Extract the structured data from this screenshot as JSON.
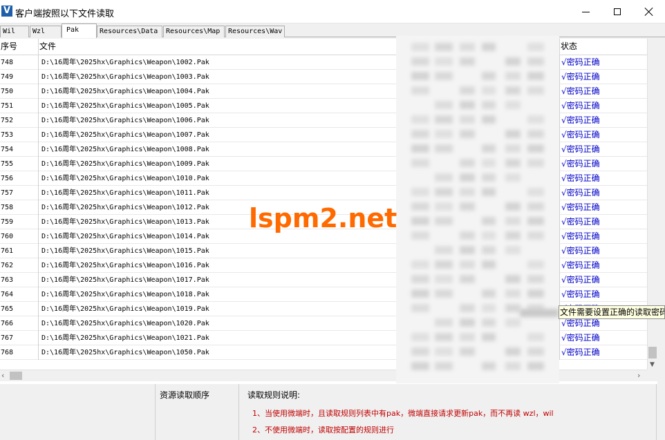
{
  "window": {
    "title": "客户端按照以下文件读取",
    "icon_letter": "V"
  },
  "tabs": [
    {
      "label": "Wil",
      "active": false
    },
    {
      "label": "Wzl",
      "active": false
    },
    {
      "label": "Pak",
      "active": true
    },
    {
      "label": "Resources\\Data",
      "active": false
    },
    {
      "label": "Resources\\Map",
      "active": false
    },
    {
      "label": "Resources\\Wav",
      "active": false
    }
  ],
  "table": {
    "columns": [
      "序号",
      "文件",
      "状态"
    ],
    "rows": [
      {
        "num": "748",
        "file": "D:\\16周年\\2025hx\\Graphics\\Weapon\\1002.Pak",
        "status": "√密码正确"
      },
      {
        "num": "749",
        "file": "D:\\16周年\\2025hx\\Graphics\\Weapon\\1003.Pak",
        "status": "√密码正确"
      },
      {
        "num": "750",
        "file": "D:\\16周年\\2025hx\\Graphics\\Weapon\\1004.Pak",
        "status": "√密码正确"
      },
      {
        "num": "751",
        "file": "D:\\16周年\\2025hx\\Graphics\\Weapon\\1005.Pak",
        "status": "√密码正确"
      },
      {
        "num": "752",
        "file": "D:\\16周年\\2025hx\\Graphics\\Weapon\\1006.Pak",
        "status": "√密码正确"
      },
      {
        "num": "753",
        "file": "D:\\16周年\\2025hx\\Graphics\\Weapon\\1007.Pak",
        "status": "√密码正确"
      },
      {
        "num": "754",
        "file": "D:\\16周年\\2025hx\\Graphics\\Weapon\\1008.Pak",
        "status": "√密码正确"
      },
      {
        "num": "755",
        "file": "D:\\16周年\\2025hx\\Graphics\\Weapon\\1009.Pak",
        "status": "√密码正确"
      },
      {
        "num": "756",
        "file": "D:\\16周年\\2025hx\\Graphics\\Weapon\\1010.Pak",
        "status": "√密码正确"
      },
      {
        "num": "757",
        "file": "D:\\16周年\\2025hx\\Graphics\\Weapon\\1011.Pak",
        "status": "√密码正确"
      },
      {
        "num": "758",
        "file": "D:\\16周年\\2025hx\\Graphics\\Weapon\\1012.Pak",
        "status": "√密码正确"
      },
      {
        "num": "759",
        "file": "D:\\16周年\\2025hx\\Graphics\\Weapon\\1013.Pak",
        "status": "√密码正确"
      },
      {
        "num": "760",
        "file": "D:\\16周年\\2025hx\\Graphics\\Weapon\\1014.Pak",
        "status": "√密码正确"
      },
      {
        "num": "761",
        "file": "D:\\16周年\\2025hx\\Graphics\\Weapon\\1015.Pak",
        "status": "√密码正确"
      },
      {
        "num": "762",
        "file": "D:\\16周年\\2025hx\\Graphics\\Weapon\\1016.Pak",
        "status": "√密码正确"
      },
      {
        "num": "763",
        "file": "D:\\16周年\\2025hx\\Graphics\\Weapon\\1017.Pak",
        "status": "√密码正确"
      },
      {
        "num": "764",
        "file": "D:\\16周年\\2025hx\\Graphics\\Weapon\\1018.Pak",
        "status": "√密码正确"
      },
      {
        "num": "765",
        "file": "D:\\16周年\\2025hx\\Graphics\\Weapon\\1019.Pak",
        "status": "√密码正确"
      },
      {
        "num": "766",
        "file": "D:\\16周年\\2025hx\\Graphics\\Weapon\\1020.Pak",
        "status": "√密码正确"
      },
      {
        "num": "767",
        "file": "D:\\16周年\\2025hx\\Graphics\\Weapon\\1021.Pak",
        "status": "√密码正确"
      },
      {
        "num": "768",
        "file": "D:\\16周年\\2025hx\\Graphics\\Weapon\\1050.Pak",
        "status": "√密码正确"
      }
    ]
  },
  "watermark": "lspm2.net",
  "tooltip": "文件需要设置正确的读取密码",
  "bottom": {
    "order_title": "资源读取顺序",
    "rules_title": "读取规则说明:",
    "rules": [
      "1、当使用微端时，且读取规则列表中有pak，微端直接请求更新pak，而不再读 wzl，wil",
      "2、不使用微端时，读取按配置的规则进行"
    ]
  },
  "colors": {
    "status_text": "#0000c8",
    "rule_text": "#c00000",
    "watermark": "#ff6a00",
    "tooltip_bg": "#ffffe1"
  }
}
